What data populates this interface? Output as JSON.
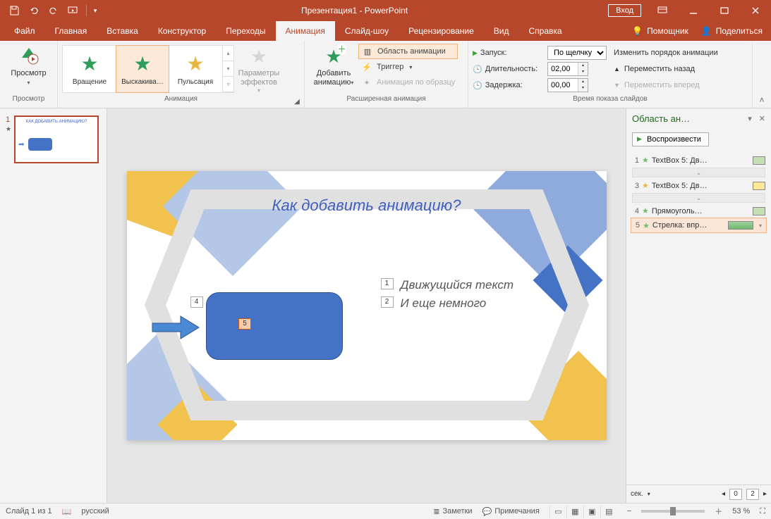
{
  "titlebar": {
    "title": "Презентация1 - PowerPoint",
    "login": "Вход"
  },
  "tabs": {
    "file": "Файл",
    "home": "Главная",
    "insert": "Вставка",
    "design": "Конструктор",
    "transitions": "Переходы",
    "animation": "Анимация",
    "slideshow": "Слайд-шоу",
    "review": "Рецензирование",
    "view": "Вид",
    "help": "Справка",
    "tellme": "Помощник",
    "share": "Поделиться"
  },
  "ribbon": {
    "preview": {
      "btn": "Просмотр",
      "group": "Просмотр"
    },
    "animation_group": {
      "label": "Анимация",
      "items": {
        "rotate": "Вращение",
        "bounce": "Выскакива…",
        "pulse": "Пульсация"
      },
      "effect_options": "Параметры эффектов"
    },
    "advanced": {
      "label": "Расширенная анимация",
      "add": "Добавить анимацию",
      "pane": "Область анимации",
      "trigger": "Триггер",
      "painter": "Анимация по образцу"
    },
    "timing": {
      "label": "Время показа слайдов",
      "start_lbl": "Запуск:",
      "start_val": "По щелчку",
      "duration_lbl": "Длительность:",
      "duration_val": "02,00",
      "delay_lbl": "Задержка:",
      "delay_val": "00,00",
      "reorder": "Изменить порядок анимации",
      "move_back": "Переместить назад",
      "move_fwd": "Переместить вперед"
    }
  },
  "thumbs": {
    "n1": "1"
  },
  "slide": {
    "title": "Как добавить анимацию?",
    "line1": "Движущийся текст",
    "line2": "И еще немного",
    "tag1": "1",
    "tag2": "2",
    "tag4": "4",
    "tag5": "5"
  },
  "apane": {
    "title": "Область ан…",
    "play": "Воспроизвести",
    "items": [
      {
        "n": "1",
        "name": "TextBox 5: Дв…",
        "color": "#A9D08E",
        "starClass": ""
      },
      {
        "n": "3",
        "name": "TextBox 5: Дв…",
        "color": "#FFE699",
        "starClass": "y"
      },
      {
        "n": "4",
        "name": "Прямоуголь…",
        "color": "#A9D08E",
        "starClass": ""
      },
      {
        "n": "5",
        "name": "Стрелка: впр…",
        "color": "#8FD08F",
        "starClass": "",
        "sel": true
      }
    ],
    "sec": "сек.",
    "seg0": "0",
    "seg2": "2"
  },
  "status": {
    "slide": "Слайд 1 из 1",
    "lang": "русский",
    "notes": "Заметки",
    "comments": "Примечания",
    "zoom": "53 %"
  }
}
